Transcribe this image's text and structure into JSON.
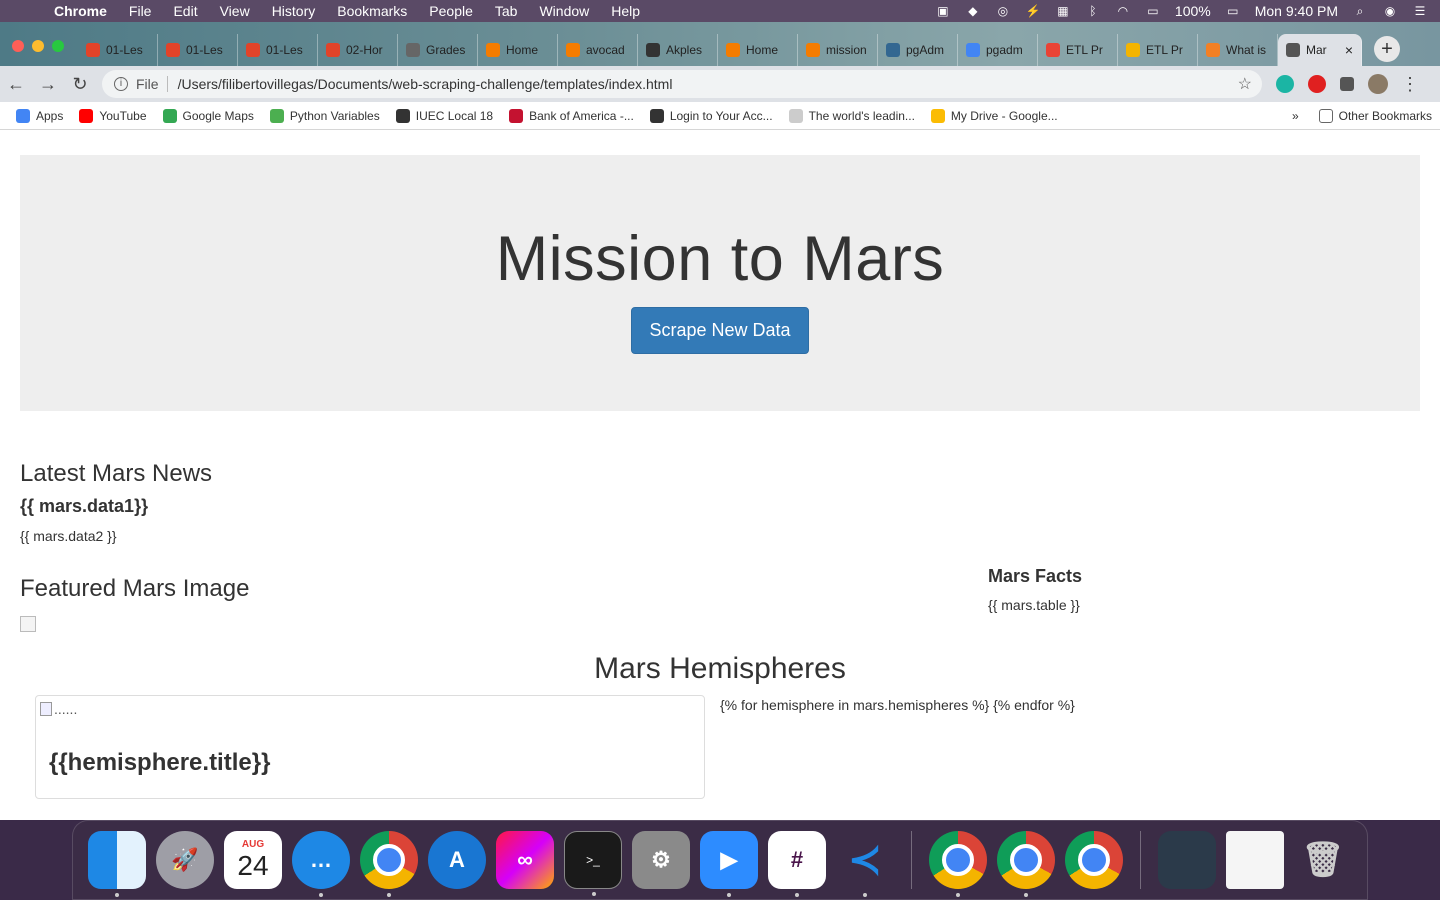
{
  "menubar": {
    "app_name": "Chrome",
    "menus": [
      "File",
      "Edit",
      "View",
      "History",
      "Bookmarks",
      "People",
      "Tab",
      "Window",
      "Help"
    ],
    "battery": "100%",
    "clock": "Mon 9:40 PM"
  },
  "tabs": [
    {
      "label": "01-Les",
      "icon": "gitlab-icon",
      "color": "#e24329"
    },
    {
      "label": "01-Les",
      "icon": "gitlab-icon",
      "color": "#e24329"
    },
    {
      "label": "01-Les",
      "icon": "gitlab-icon",
      "color": "#e24329"
    },
    {
      "label": "02-Hor",
      "icon": "gitlab-icon",
      "color": "#e24329"
    },
    {
      "label": "Grades",
      "icon": "globe-icon",
      "color": "#666666"
    },
    {
      "label": "Home",
      "icon": "refresh-icon",
      "color": "#f57c00"
    },
    {
      "label": "avocad",
      "icon": "file-icon",
      "color": "#f57c00"
    },
    {
      "label": "Akples",
      "icon": "github-icon",
      "color": "#333333"
    },
    {
      "label": "Home",
      "icon": "refresh-icon",
      "color": "#f57c00"
    },
    {
      "label": "mission",
      "icon": "file-icon",
      "color": "#f57c00"
    },
    {
      "label": "pgAdm",
      "icon": "pg-icon",
      "color": "#336791"
    },
    {
      "label": "pgadm",
      "icon": "google-icon",
      "color": "#4285f4"
    },
    {
      "label": "ETL Pr",
      "icon": "gmail-icon",
      "color": "#ea4335"
    },
    {
      "label": "ETL Pr",
      "icon": "slides-icon",
      "color": "#f4b400"
    },
    {
      "label": "What is",
      "icon": "stack-icon",
      "color": "#f48024"
    },
    {
      "label": "Mar",
      "icon": "globe-icon",
      "color": "#555555",
      "active": true
    }
  ],
  "toolbar": {
    "scheme": "File",
    "url": "/Users/filibertovillegas/Documents/web-scraping-challenge/templates/index.html"
  },
  "bookmarks": {
    "items": [
      {
        "label": "Apps",
        "color": "#4285f4"
      },
      {
        "label": "YouTube",
        "color": "#ff0000"
      },
      {
        "label": "Google Maps",
        "color": "#34a853"
      },
      {
        "label": "Python Variables",
        "color": "#4caf50"
      },
      {
        "label": "IUEC Local 18",
        "color": "#333333"
      },
      {
        "label": "Bank of America -...",
        "color": "#c41230"
      },
      {
        "label": "Login to Your Acc...",
        "color": "#333333"
      },
      {
        "label": "The world's leadin...",
        "color": "#cccccc"
      },
      {
        "label": "My Drive - Google...",
        "color": "#fbbc04"
      }
    ],
    "more": "»",
    "other": "Other Bookmarks"
  },
  "page": {
    "title": "Mission to Mars",
    "scrape_button": "Scrape New Data",
    "news_heading": "Latest Mars News",
    "news_title": "{{ mars.data1}}",
    "news_body": "{{ mars.data2 }}",
    "image_heading": "Featured Mars Image",
    "facts_heading": "Mars Facts",
    "facts_table": "{{ mars.table }}",
    "hemispheres_heading": "Mars Hemispheres",
    "hemi_loop": "{% for hemisphere in mars.hemispheres %} {% endfor %}",
    "hemi_alt": "......",
    "hemi_title": "{{hemisphere.title}}"
  },
  "dock": {
    "calendar_month": "AUG",
    "calendar_day": "24"
  },
  "colors": {
    "primary_button": "#337ab7",
    "jumbotron_bg": "#eeeeee"
  }
}
